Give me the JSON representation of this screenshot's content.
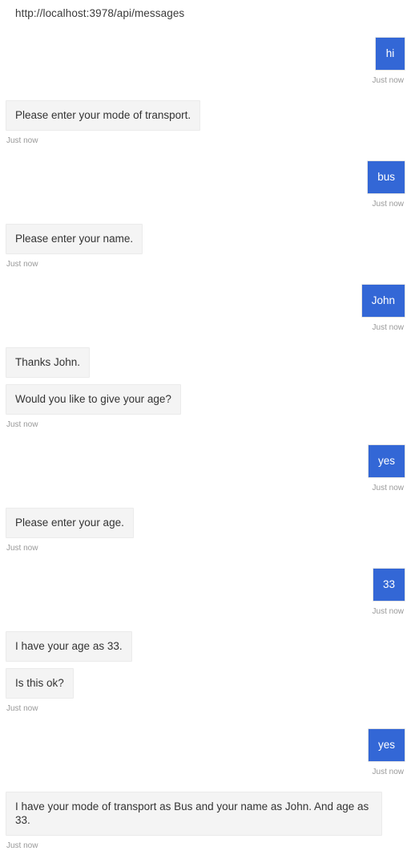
{
  "header": {
    "endpoint": "http://localhost:3978/api/messages"
  },
  "labels": {
    "timestamp": "Just now"
  },
  "colors": {
    "user_bubble": "#3367d6",
    "user_text": "#ffffff",
    "bot_bubble": "#f4f4f4",
    "bot_border": "#ebebeb",
    "bot_text": "#333333",
    "timestamp_text": "#999999",
    "page_background": "#ffffff"
  },
  "conversation": [
    {
      "from": "user",
      "bubbles": [
        "hi"
      ],
      "timestamp": "Just now"
    },
    {
      "from": "bot",
      "bubbles": [
        "Please enter your mode of transport."
      ],
      "timestamp": "Just now"
    },
    {
      "from": "user",
      "bubbles": [
        "bus"
      ],
      "timestamp": "Just now"
    },
    {
      "from": "bot",
      "bubbles": [
        "Please enter your name."
      ],
      "timestamp": "Just now"
    },
    {
      "from": "user",
      "bubbles": [
        "John"
      ],
      "timestamp": "Just now"
    },
    {
      "from": "bot",
      "bubbles": [
        "Thanks John.",
        "Would you like to give your age?"
      ],
      "timestamp": "Just now"
    },
    {
      "from": "user",
      "bubbles": [
        "yes"
      ],
      "timestamp": "Just now"
    },
    {
      "from": "bot",
      "bubbles": [
        "Please enter your age."
      ],
      "timestamp": "Just now"
    },
    {
      "from": "user",
      "bubbles": [
        "33"
      ],
      "timestamp": "Just now"
    },
    {
      "from": "bot",
      "bubbles": [
        "I have your age as 33.",
        "Is this ok?"
      ],
      "timestamp": "Just now"
    },
    {
      "from": "user",
      "bubbles": [
        "yes"
      ],
      "timestamp": "Just now"
    },
    {
      "from": "bot",
      "bubbles": [
        "I have your mode of transport as Bus and your name as John. And age as 33."
      ],
      "timestamp": "Just now"
    }
  ]
}
